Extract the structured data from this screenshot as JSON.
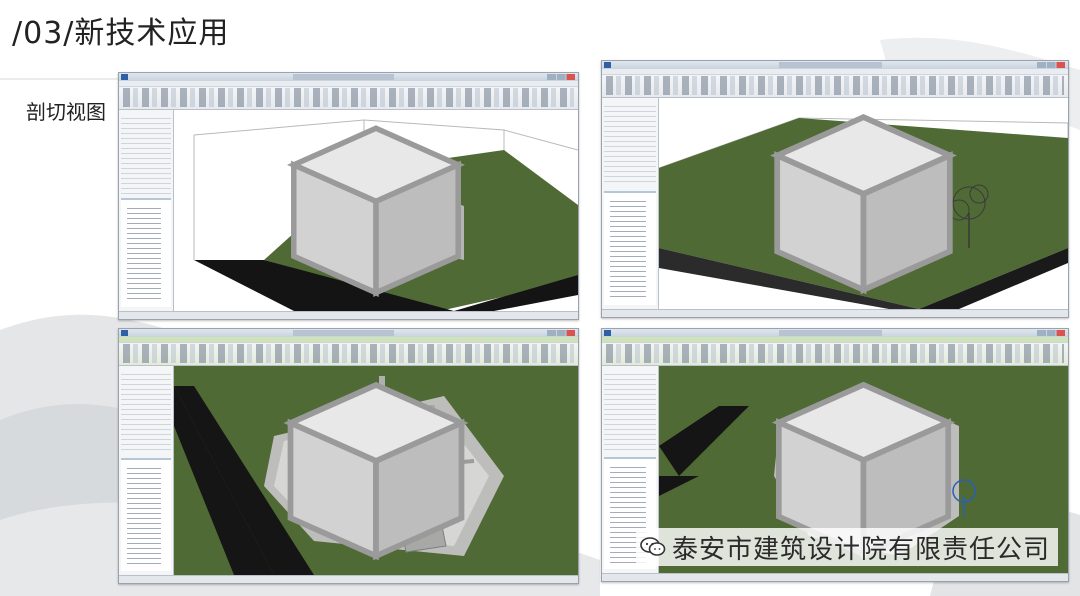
{
  "page": {
    "title": "/03/新技术应用",
    "section": "剖切视图"
  },
  "screenshots": [
    {
      "id": "top-left",
      "view": "revit-section-box-exterior"
    },
    {
      "id": "top-right",
      "view": "revit-section-box-exterior-with-tree-car"
    },
    {
      "id": "bottom-left",
      "view": "revit-section-box-interior-plan"
    },
    {
      "id": "bottom-right",
      "view": "revit-section-box-interior-plan"
    }
  ],
  "watermark": {
    "text": "泰安市建筑设计院有限责任公司",
    "icon": "wechat-icon"
  },
  "colors": {
    "grass": "#4f6a35",
    "road": "#141414",
    "wall": "#c9c9c7",
    "roof": "#6e7378",
    "floor": "#d9c49a"
  }
}
